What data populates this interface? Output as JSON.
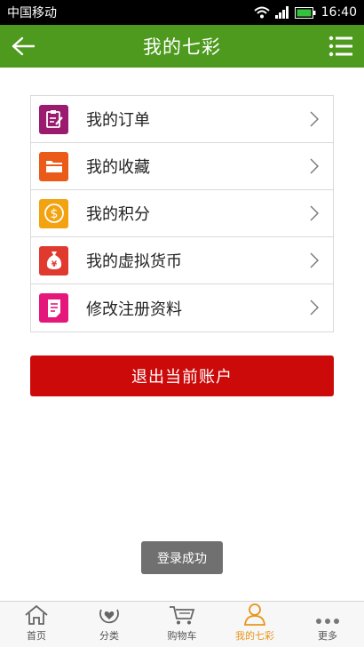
{
  "status_bar": {
    "carrier": "中国移动",
    "time": "16:40"
  },
  "header": {
    "title": "我的七彩"
  },
  "menu": [
    {
      "label": "我的订单",
      "icon": "order-icon",
      "color": "#9b1b6f"
    },
    {
      "label": "我的收藏",
      "icon": "folder-icon",
      "color": "#ea5a18"
    },
    {
      "label": "我的积分",
      "icon": "coin-icon",
      "color": "#f2a30f"
    },
    {
      "label": "我的虚拟货币",
      "icon": "money-bag-icon",
      "color": "#e03a2f"
    },
    {
      "label": "修改注册资料",
      "icon": "document-icon",
      "color": "#e5177b"
    }
  ],
  "logout_label": "退出当前账户",
  "toast": "登录成功",
  "tabs": [
    {
      "label": "首页",
      "icon": "home-icon",
      "active": false
    },
    {
      "label": "分类",
      "icon": "category-icon",
      "active": false
    },
    {
      "label": "购物车",
      "icon": "cart-icon",
      "active": false
    },
    {
      "label": "我的七彩",
      "icon": "user-icon",
      "active": true
    },
    {
      "label": "更多",
      "icon": "more-icon",
      "active": false
    }
  ],
  "colors": {
    "header_bg": "#4e9a1e",
    "logout_bg": "#cc0a0a",
    "active_tab": "#e8951a"
  }
}
